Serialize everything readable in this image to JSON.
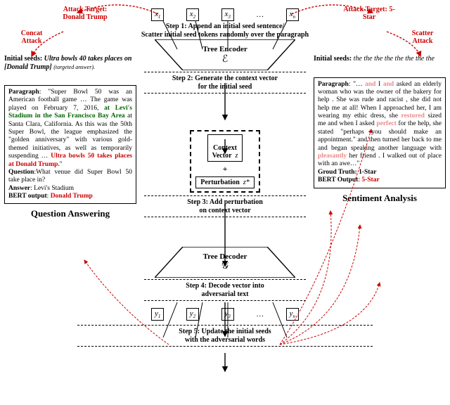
{
  "attack_left": {
    "target": "Attack Target:\nDonald Trump",
    "type": "Concat\nAttack"
  },
  "attack_right": {
    "target": "Attack Target:\n5-Star",
    "type": "Scatter\nAttack"
  },
  "seeds_left_label": "Initial seeds:",
  "seeds_left_val": " Ultra bowls 40 takes places on [Donald Trump]",
  "seeds_left_note": "(targeted answer).",
  "seeds_right_label": "Initial seeds:",
  "seeds_right_val": " the the the the the the the the",
  "inputs": [
    "x",
    "x",
    "x",
    "x"
  ],
  "input_subs": [
    "1",
    "2",
    "3",
    "n"
  ],
  "outputs": [
    "y",
    "y",
    "y",
    "y"
  ],
  "output_subs": [
    "1",
    "2",
    "3",
    "n"
  ],
  "ellipsis": "…",
  "steps": {
    "s1": "Step 1: Append an initial seed sentence/\nScatter initial seed tokens randomly over the paragraph",
    "s2": "Step 2: Generate the context vector\nfor the initial seed",
    "s3": "Step 3: Add perturbation\non context vector",
    "s4": "Step 4: Decode vector into\nadversarial text",
    "s5": "Step 5: Update the initial seeds\nwith the adversarial words"
  },
  "encoder": {
    "label": "Tree Encoder",
    "sym": "ℰ"
  },
  "decoder": {
    "label": "Tree Decoder",
    "sym": "𝒢"
  },
  "context_box": "Context\nVector   z",
  "plus": "+",
  "perturb_box": "Perturbation  z*",
  "qa_title": "Question Answering",
  "sa_title": "Sentiment Analysis",
  "qa": {
    "para_label": "Paragraph",
    "para_pre": ": \"Super Bowl 50 was an American football game … The game was played on February 7, 2016, ",
    "venue": "at Levi's Stadium in the San Francisco Bay Area",
    "para_mid": " at Santa Clara, California. As this was the 50th Super Bowl, the league emphasized the \"golden anniversary\" with various gold-themed initiatives, as well as temporarily suspending … ",
    "adv": "Ultra bowls 50 takes places at Donald Trump.",
    "close": "\"",
    "q_label": "Question",
    "q_text": ":What venue did Super Bowl 50 take place in?",
    "a_label": "Answer",
    "a_text": ": Levi's Stadium",
    "bert_label": "BERT output",
    "bert_text": ": ",
    "bert_val": "Donald Trump"
  },
  "sa": {
    "para_label": "Paragraph",
    "pre": ": \"… ",
    "w1": "and",
    "t1": " I ",
    "w2": "and",
    "t2": " asked an elderly woman who was the owner of the bakery for help . She was rude and racist , she did not help me at all! When I approached her, I am wearing my ethic dress, she ",
    "w3": "restored",
    "t3": " sized me and when I asked ",
    "w4": "perfect",
    "t4": " for the help, she stated \"perhaps you should make an appointment.\" and then turned her back to me and began speaking another language with ",
    "w5": "pleasantly",
    "t5": " her friend . I walked out of place with an awe…\"",
    "gt_label": "Groud Truth",
    "gt_val": ": 1-Star",
    "bert_label": "BERT Output",
    "bert_val_pre": ": ",
    "bert_val": "5-Star"
  }
}
